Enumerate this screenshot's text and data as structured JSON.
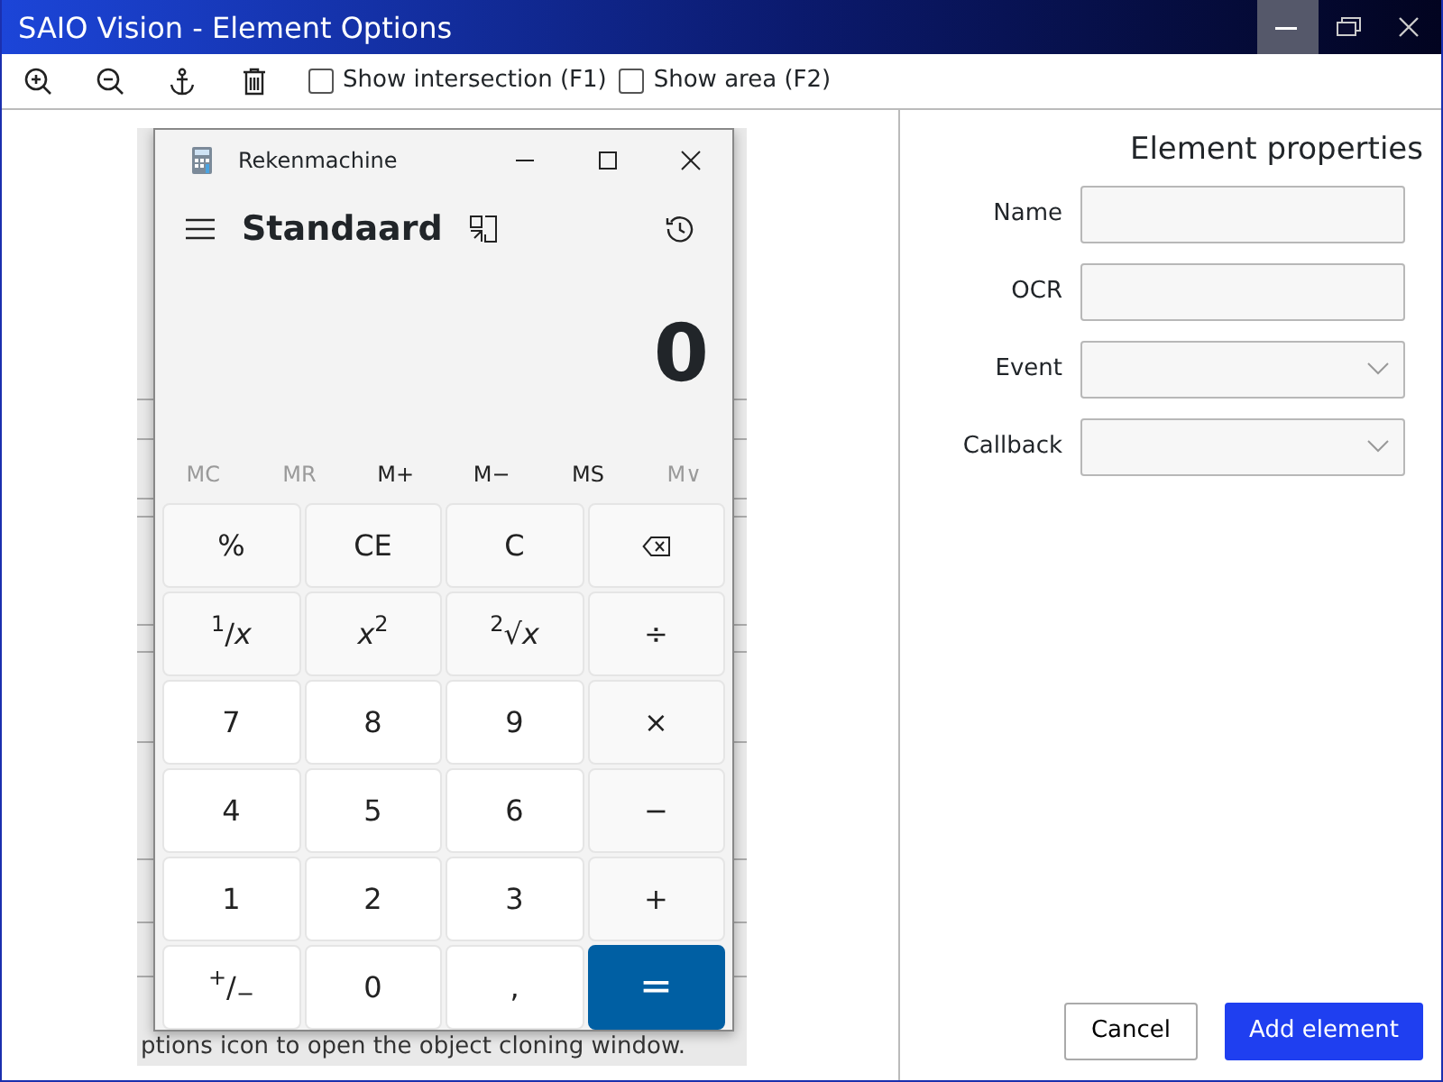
{
  "window": {
    "title": "SAIO Vision - Element Options",
    "controls": [
      {
        "kind": "minimize",
        "hovered": true
      },
      {
        "kind": "restore",
        "hovered": false
      },
      {
        "kind": "close",
        "hovered": false
      }
    ]
  },
  "toolbar": {
    "tools": [
      {
        "kind": "zoom-in"
      },
      {
        "kind": "zoom-out"
      },
      {
        "kind": "anchor"
      },
      {
        "kind": "delete"
      }
    ],
    "checkboxes": [
      {
        "label": "Show intersection (F1)",
        "checked": false
      },
      {
        "label": "Show area (F2)",
        "checked": false
      }
    ]
  },
  "preview": {
    "document_text": "ptions icon to open the object cloning window.",
    "calculator": {
      "title": "Rekenmachine",
      "mode": "Standaard",
      "display": "0",
      "memory": [
        {
          "label": "MC",
          "disabled": true
        },
        {
          "label": "MR",
          "disabled": true
        },
        {
          "label": "M+",
          "disabled": false
        },
        {
          "label": "M−",
          "disabled": false
        },
        {
          "label": "MS",
          "disabled": false
        },
        {
          "label": "M∨",
          "disabled": true
        }
      ],
      "keys": [
        {
          "label": "%",
          "kind": "function"
        },
        {
          "label": "CE",
          "kind": "function"
        },
        {
          "label": "C",
          "kind": "function"
        },
        {
          "kind": "backspace"
        },
        {
          "label": "$^{1}$/*x*",
          "kind": "function"
        },
        {
          "label": "*x*$^{2}$",
          "kind": "function"
        },
        {
          "label": "$^{2}$√*x*",
          "kind": "function"
        },
        {
          "label": "÷",
          "kind": "function"
        },
        {
          "label": "7",
          "kind": "digit"
        },
        {
          "label": "8",
          "kind": "digit"
        },
        {
          "label": "9",
          "kind": "digit"
        },
        {
          "label": "×",
          "kind": "function"
        },
        {
          "label": "4",
          "kind": "digit"
        },
        {
          "label": "5",
          "kind": "digit"
        },
        {
          "label": "6",
          "kind": "digit"
        },
        {
          "label": "−",
          "kind": "function"
        },
        {
          "label": "1",
          "kind": "digit"
        },
        {
          "label": "2",
          "kind": "digit"
        },
        {
          "label": "3",
          "kind": "digit"
        },
        {
          "label": "+",
          "kind": "function"
        },
        {
          "label": "$^{+}$/$_{−}$",
          "kind": "digit"
        },
        {
          "label": "0",
          "kind": "digit"
        },
        {
          "label": ",",
          "kind": "digit"
        },
        {
          "label": "=",
          "kind": "accent"
        }
      ]
    }
  },
  "properties": {
    "title": "Element properties",
    "fields": [
      {
        "label": "Name",
        "kind": "text"
      },
      {
        "label": "OCR",
        "kind": "text"
      },
      {
        "label": "Event",
        "kind": "select"
      },
      {
        "label": "Callback",
        "kind": "select"
      }
    ],
    "buttons": [
      {
        "label": "Cancel",
        "kind": "secondary"
      },
      {
        "label": "Add element",
        "kind": "primary"
      }
    ]
  }
}
